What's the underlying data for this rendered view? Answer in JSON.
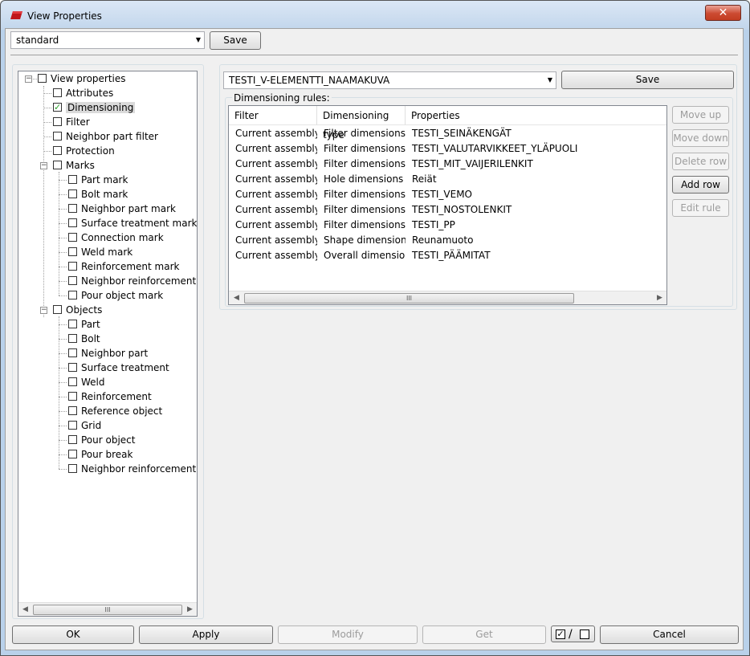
{
  "window": {
    "title": "View Properties",
    "close_symbol": "✕"
  },
  "top": {
    "preset_value": "standard",
    "save_label": "Save"
  },
  "rules_panel": {
    "view_value": "TESTI_V-ELEMENTTI_NAAMAKUVA",
    "save_label": "Save",
    "group_label": "Dimensioning rules:",
    "columns": [
      "Filter",
      "Dimensioning type",
      "Properties"
    ],
    "rows": [
      [
        "Current assembly",
        "Filter dimensions",
        "TESTI_SEINÄKENGÄT"
      ],
      [
        "Current assembly",
        "Filter dimensions",
        "TESTI_VALUTARVIKKEET_YLÄPUOLI"
      ],
      [
        "Current assembly",
        "Filter dimensions",
        "TESTI_MIT_VAIJERILENKIT"
      ],
      [
        "Current assembly",
        "Hole dimensions",
        "Reiät"
      ],
      [
        "Current assembly",
        "Filter dimensions",
        "TESTI_VEMO"
      ],
      [
        "Current assembly",
        "Filter dimensions",
        "TESTI_NOSTOLENKIT"
      ],
      [
        "Current assembly",
        "Filter dimensions",
        "TESTI_PP"
      ],
      [
        "Current assembly",
        "Shape dimensions",
        "Reunamuoto"
      ],
      [
        "Current assembly",
        "Overall dimensio...",
        "TESTI_PÄÄMITAT"
      ]
    ],
    "side_buttons": {
      "move_up": "Move up",
      "move_down": "Move down",
      "delete_row": "Delete row",
      "add_row": "Add row",
      "edit_rule": "Edit rule"
    }
  },
  "tree": {
    "root": "View properties",
    "items": [
      {
        "label": "Attributes",
        "checked": false
      },
      {
        "label": "Dimensioning",
        "checked": true,
        "selected": true
      },
      {
        "label": "Filter",
        "checked": false
      },
      {
        "label": "Neighbor part filter",
        "checked": false
      },
      {
        "label": "Protection",
        "checked": false
      },
      {
        "label": "Marks",
        "checked": false,
        "expandable": true
      },
      {
        "label": "Part mark",
        "checked": false,
        "child": true
      },
      {
        "label": "Bolt mark",
        "checked": false,
        "child": true
      },
      {
        "label": "Neighbor part mark",
        "checked": false,
        "child": true
      },
      {
        "label": "Surface treatment mark",
        "checked": false,
        "child": true
      },
      {
        "label": "Connection mark",
        "checked": false,
        "child": true
      },
      {
        "label": "Weld mark",
        "checked": false,
        "child": true
      },
      {
        "label": "Reinforcement mark",
        "checked": false,
        "child": true
      },
      {
        "label": "Neighbor reinforcement ma",
        "checked": false,
        "child": true
      },
      {
        "label": "Pour object mark",
        "checked": false,
        "child": true
      },
      {
        "label": "Objects",
        "checked": false,
        "expandable": true
      },
      {
        "label": "Part",
        "checked": false,
        "child": true
      },
      {
        "label": "Bolt",
        "checked": false,
        "child": true
      },
      {
        "label": "Neighbor part",
        "checked": false,
        "child": true
      },
      {
        "label": "Surface treatment",
        "checked": false,
        "child": true
      },
      {
        "label": "Weld",
        "checked": false,
        "child": true
      },
      {
        "label": "Reinforcement",
        "checked": false,
        "child": true
      },
      {
        "label": "Reference object",
        "checked": false,
        "child": true
      },
      {
        "label": "Grid",
        "checked": false,
        "child": true
      },
      {
        "label": "Pour object",
        "checked": false,
        "child": true
      },
      {
        "label": "Pour break",
        "checked": false,
        "child": true
      },
      {
        "label": "Neighbor reinforcement",
        "checked": false,
        "child": true
      }
    ]
  },
  "footer": {
    "ok": "OK",
    "apply": "Apply",
    "modify": "Modify",
    "get": "Get",
    "toggle_separator": "/",
    "cancel": "Cancel"
  },
  "scroll_grip": "III"
}
